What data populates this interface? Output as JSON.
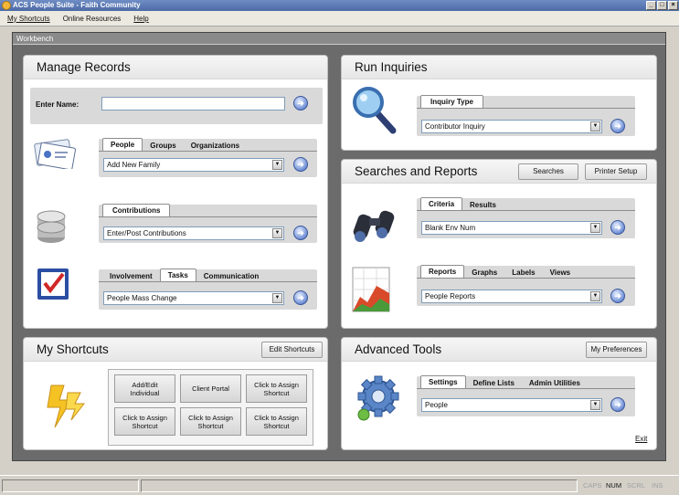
{
  "window": {
    "title": "ACS People Suite - Faith Community"
  },
  "menu": [
    "My Shortcuts",
    "Online Resources",
    "Help"
  ],
  "workbench": {
    "title": "Workbench"
  },
  "manage_records": {
    "title": "Manage Records",
    "enter_name_label": "Enter Name:",
    "enter_name_value": "",
    "people": {
      "tabs": [
        "People",
        "Groups",
        "Organizations"
      ],
      "active": 0,
      "selected": "Add New Family"
    },
    "contributions": {
      "tabs": [
        "Contributions"
      ],
      "active": 0,
      "selected": "Enter/Post Contributions"
    },
    "involvement": {
      "tabs": [
        "Involvement",
        "Tasks",
        "Communication"
      ],
      "active": 1,
      "selected": "People Mass Change"
    }
  },
  "run_inquiries": {
    "title": "Run Inquiries",
    "tabs": [
      "Inquiry Type"
    ],
    "selected": "Contributor Inquiry"
  },
  "searches_reports": {
    "title": "Searches and Reports",
    "searches_button": "Searches",
    "printer_setup_button": "Printer Setup",
    "criteria": {
      "tabs": [
        "Criteria",
        "Results"
      ],
      "active": 0,
      "selected": "Blank Env Num"
    },
    "reports": {
      "tabs": [
        "Reports",
        "Graphs",
        "Labels",
        "Views"
      ],
      "active": 0,
      "selected": "People Reports"
    }
  },
  "my_shortcuts": {
    "title": "My Shortcuts",
    "edit_button": "Edit Shortcuts",
    "buttons": [
      [
        "Add/Edit",
        "Individual"
      ],
      [
        "Client Portal"
      ],
      [
        "Click to Assign",
        "Shortcut"
      ],
      [
        "Click to Assign",
        "Shortcut"
      ],
      [
        "Click to Assign",
        "Shortcut"
      ],
      [
        "Click to Assign",
        "Shortcut"
      ]
    ]
  },
  "advanced_tools": {
    "title": "Advanced Tools",
    "preferences_button": "My Preferences",
    "tabs": [
      "Settings",
      "Define Lists",
      "Admin Utilities"
    ],
    "active": 0,
    "selected": "People",
    "exit_link": "Exit"
  },
  "status_indicators": [
    {
      "label": "CAPS",
      "on": false
    },
    {
      "label": "NUM",
      "on": true
    },
    {
      "label": "SCRL",
      "on": false
    },
    {
      "label": "INS",
      "on": false
    }
  ],
  "colors": {
    "accent": "#4b6aa6",
    "go_button": "#6f8fd6",
    "panel_bg": "#ffffff",
    "workspace": "#6b6b6b"
  }
}
